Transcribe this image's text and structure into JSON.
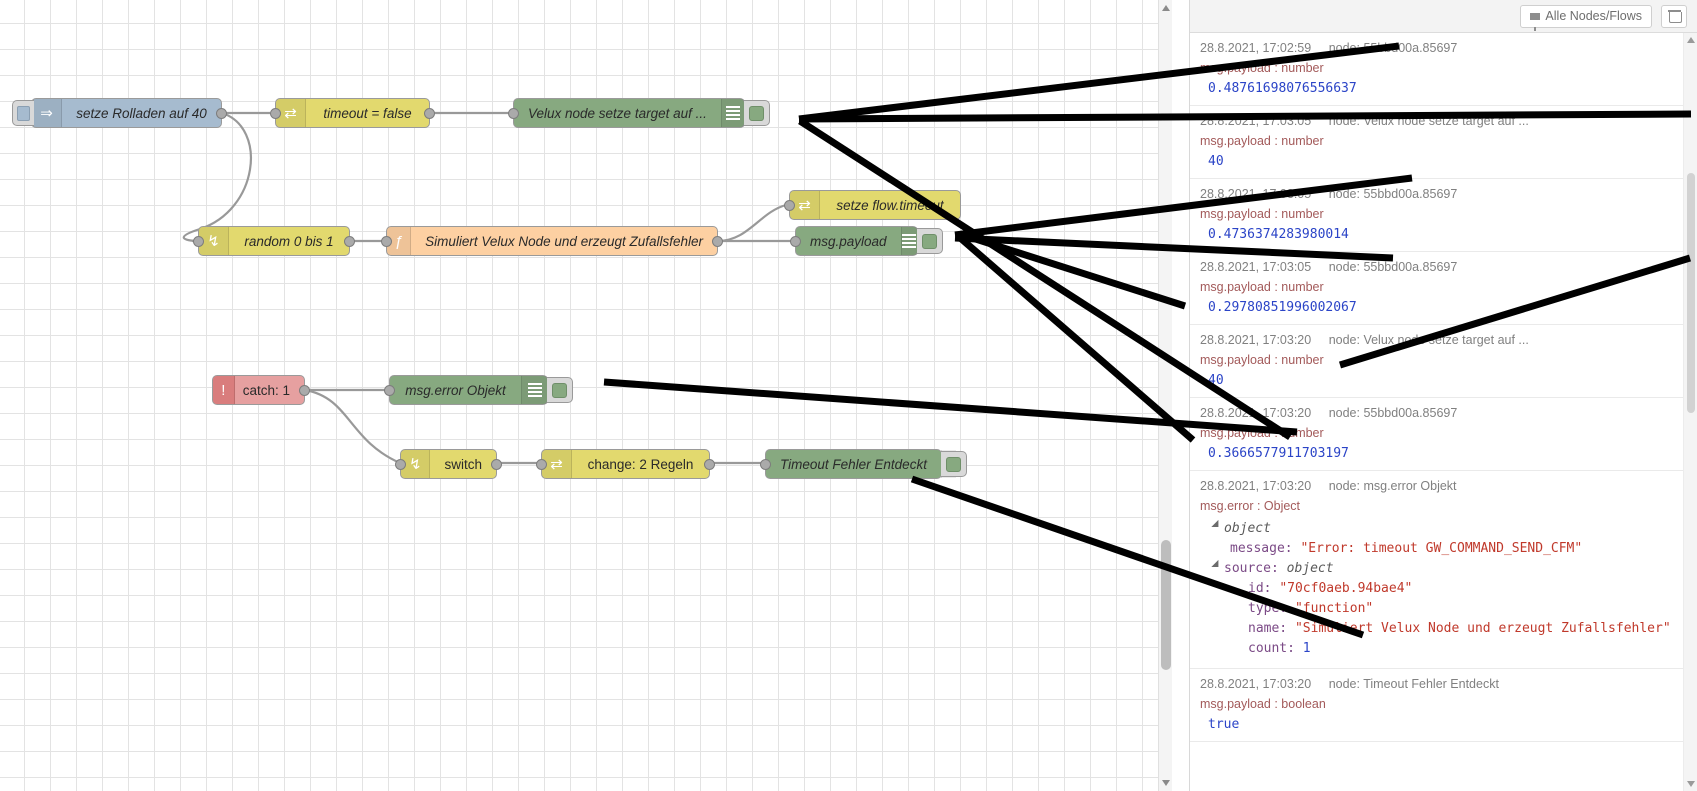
{
  "sidebar": {
    "filter_button_label": "Alle Nodes/Flows",
    "clear_button_label": "",
    "messages": [
      {
        "timestamp": "28.8.2021, 17:02:59",
        "node": "node: 55bbd00a.85697",
        "topic": "msg.payload : number",
        "value": "0.48761698076556637",
        "type": "number"
      },
      {
        "timestamp": "28.8.2021, 17:03:05",
        "node": "node: Velux node setze target auf ...",
        "topic": "msg.payload : number",
        "value": "40",
        "type": "number"
      },
      {
        "timestamp": "28.8.2021, 17:03:05",
        "node": "node: 55bbd00a.85697",
        "topic": "msg.payload : number",
        "value": "0.4736374283980014",
        "type": "number"
      },
      {
        "timestamp": "28.8.2021, 17:03:05",
        "node": "node: 55bbd00a.85697",
        "topic": "msg.payload : number",
        "value": "0.29780851996002067",
        "type": "number"
      },
      {
        "timestamp": "28.8.2021, 17:03:20",
        "node": "node: Velux node setze target auf ...",
        "topic": "msg.payload : number",
        "value": "40",
        "type": "number"
      },
      {
        "timestamp": "28.8.2021, 17:03:20",
        "node": "node: 55bbd00a.85697",
        "topic": "msg.payload : number",
        "value": "0.3666577911703197",
        "type": "number"
      }
    ],
    "error_message": {
      "timestamp": "28.8.2021, 17:03:20",
      "node": "node: msg.error Objekt",
      "topic": "msg.error : Object",
      "root_label": "object",
      "fields": {
        "message_key": "message: ",
        "message_value": "\"Error: timeout GW_COMMAND_SEND_CFM\"",
        "source_key": "source: ",
        "source_type": "object",
        "id_key": "id: ",
        "id_value": "\"70cf0aeb.94bae4\"",
        "type_key": "type: ",
        "type_value": "\"function\"",
        "name_key": "name: ",
        "name_value": "\"Simuliert Velux Node und erzeugt Zufallsfehler\"",
        "count_key": "count: ",
        "count_value": "1"
      }
    },
    "boolean_message": {
      "timestamp": "28.8.2021, 17:03:20",
      "node": "node: Timeout Fehler Entdeckt",
      "topic": "msg.payload : boolean",
      "value": "true"
    }
  },
  "canvas": {
    "nodes": [
      {
        "id": "inject",
        "label": "setze Rolladen auf 40",
        "icon": "inject-arrow-icon",
        "type": "inject"
      },
      {
        "id": "change1",
        "label": "timeout = false",
        "icon": "change-icon",
        "type": "change"
      },
      {
        "id": "debug1",
        "label": "Velux node setze target auf ...",
        "icon": "debug-bars-icon",
        "type": "debug"
      },
      {
        "id": "switch1",
        "label": "random 0 bis 1",
        "icon": "switch-icon",
        "type": "switch"
      },
      {
        "id": "func1",
        "label": "Simuliert Velux Node und erzeugt Zufallsfehler",
        "icon": "function-icon",
        "type": "function"
      },
      {
        "id": "change2",
        "label": "setze flow.timeout",
        "icon": "change-icon",
        "type": "change"
      },
      {
        "id": "debug2",
        "label": "msg.payload",
        "icon": "debug-bars-icon",
        "type": "debug"
      },
      {
        "id": "catch1",
        "label": "catch: 1",
        "icon": "catch-warning-icon",
        "type": "catch"
      },
      {
        "id": "debug3",
        "label": "msg.error Objekt",
        "icon": "debug-bars-icon",
        "type": "debug"
      },
      {
        "id": "switch2",
        "label": "switch",
        "icon": "switch-icon",
        "type": "switch"
      },
      {
        "id": "change3",
        "label": "change: 2 Regeln",
        "icon": "change-icon",
        "type": "change"
      },
      {
        "id": "debug4",
        "label": "Timeout Fehler Entdeckt",
        "icon": "debug-bars-icon",
        "type": "debug"
      }
    ]
  },
  "colors": {
    "inject": "#a6bbcf",
    "change": "#e2d96e",
    "function": "#fdd0a2",
    "debug": "#87a980",
    "catch": "#e6a0a0",
    "value_text": "#2b44c7",
    "topic_text": "#a35a5a",
    "meta_text": "#808080"
  }
}
